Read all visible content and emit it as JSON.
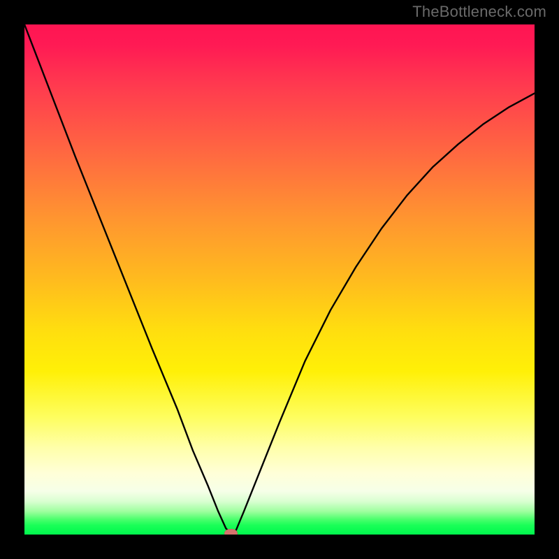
{
  "watermark": "TheBottleneck.com",
  "chart_data": {
    "type": "line",
    "title": "",
    "xlabel": "",
    "ylabel": "",
    "xlim": [
      0,
      1
    ],
    "ylim": [
      0,
      1
    ],
    "series": [
      {
        "name": "bottleneck-curve",
        "x": [
          0.0,
          0.05,
          0.1,
          0.15,
          0.2,
          0.25,
          0.3,
          0.33,
          0.36,
          0.38,
          0.395,
          0.405,
          0.415,
          0.43,
          0.46,
          0.5,
          0.55,
          0.6,
          0.65,
          0.7,
          0.75,
          0.8,
          0.85,
          0.9,
          0.95,
          1.0
        ],
        "y": [
          1.0,
          0.87,
          0.74,
          0.615,
          0.49,
          0.365,
          0.245,
          0.165,
          0.095,
          0.045,
          0.012,
          0.002,
          0.009,
          0.045,
          0.12,
          0.22,
          0.34,
          0.44,
          0.525,
          0.6,
          0.665,
          0.72,
          0.765,
          0.805,
          0.838,
          0.865
        ]
      }
    ],
    "annotations": [
      {
        "name": "optimal-marker",
        "x": 0.405,
        "y": 0.002
      }
    ],
    "background_gradient": {
      "stops": [
        {
          "pos": 0.0,
          "color": "#ff1552"
        },
        {
          "pos": 0.5,
          "color": "#ffbb1e"
        },
        {
          "pos": 0.77,
          "color": "#fefe5f"
        },
        {
          "pos": 0.93,
          "color": "#d9ffd1"
        },
        {
          "pos": 1.0,
          "color": "#00f74d"
        }
      ]
    }
  }
}
